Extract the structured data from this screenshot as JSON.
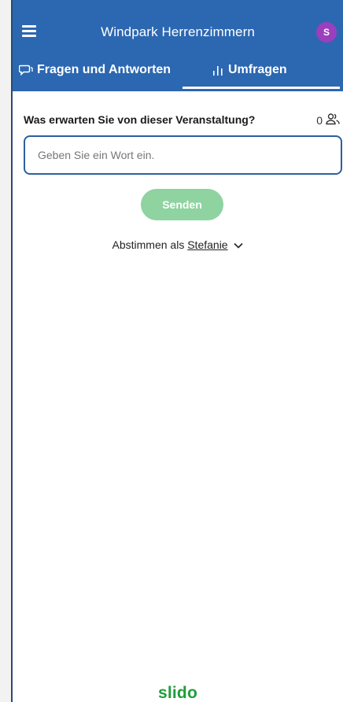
{
  "header": {
    "event_title": "Windpark Herrenzimmern",
    "avatar_initial": "S"
  },
  "tabs": [
    {
      "label": "Fragen und Antworten",
      "icon": "speech-bubbles-icon",
      "active": false
    },
    {
      "label": "Umfragen",
      "icon": "bar-chart-icon",
      "active": true
    }
  ],
  "poll": {
    "question": "Was erwarten Sie von dieser Veranstaltung?",
    "participant_count": "0",
    "participant_icon": "participants-icon",
    "input_placeholder": "Geben Sie ein Wort ein.",
    "send_label": "Senden"
  },
  "vote_as": {
    "prefix": "Abstimmen als",
    "user_name": "Stefanie"
  },
  "brand": "slido",
  "colors": {
    "header_bg": "#2c67b1",
    "input_border": "#2c5fa0",
    "send_button_bg": "#8fd3a0",
    "brand_green": "#1f9d3a",
    "avatar_bg": "#9b3fbf"
  }
}
